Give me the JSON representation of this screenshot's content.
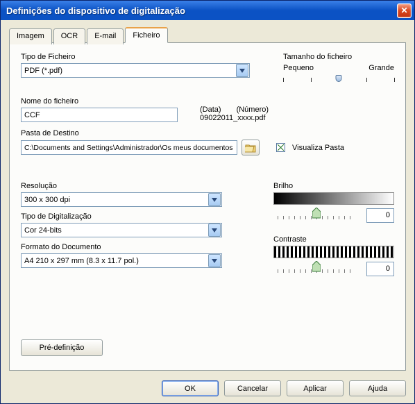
{
  "window": {
    "title": "Definições do dispositivo de digitalização",
    "close_icon": "close-icon"
  },
  "tabs": {
    "imagem": "Imagem",
    "ocr": "OCR",
    "email": "E-mail",
    "ficheiro": "Ficheiro"
  },
  "file_panel": {
    "file_type_label": "Tipo de Ficheiro",
    "file_type_value": "PDF (*.pdf)",
    "file_size_label": "Tamanho do ficheiro",
    "size_small": "Pequeno",
    "size_large": "Grande",
    "filename_label": "Nome do ficheiro",
    "filename_value": "CCF",
    "date_hdr": "(Data)",
    "number_hdr": "(Número)",
    "sample_filename": "09022011_xxxx.pdf",
    "dest_label": "Pasta de Destino",
    "dest_value": "C:\\Documents and Settings\\Administrador\\Os meus documentos",
    "view_folder_label": "Visualiza Pasta"
  },
  "scan": {
    "resolution_label": "Resolução",
    "resolution_value": "300 x 300 dpi",
    "scan_type_label": "Tipo de Digitalização",
    "scan_type_value": "Cor 24-bits",
    "doc_format_label": "Formato do Documento",
    "doc_format_value": "A4 210 x 297 mm (8.3 x 11.7 pol.)",
    "brightness_label": "Brilho",
    "brightness_value": "0",
    "contrast_label": "Contraste",
    "contrast_value": "0"
  },
  "buttons": {
    "predef": "Pré-definição",
    "ok": "OK",
    "cancel": "Cancelar",
    "apply": "Aplicar",
    "help": "Ajuda"
  }
}
